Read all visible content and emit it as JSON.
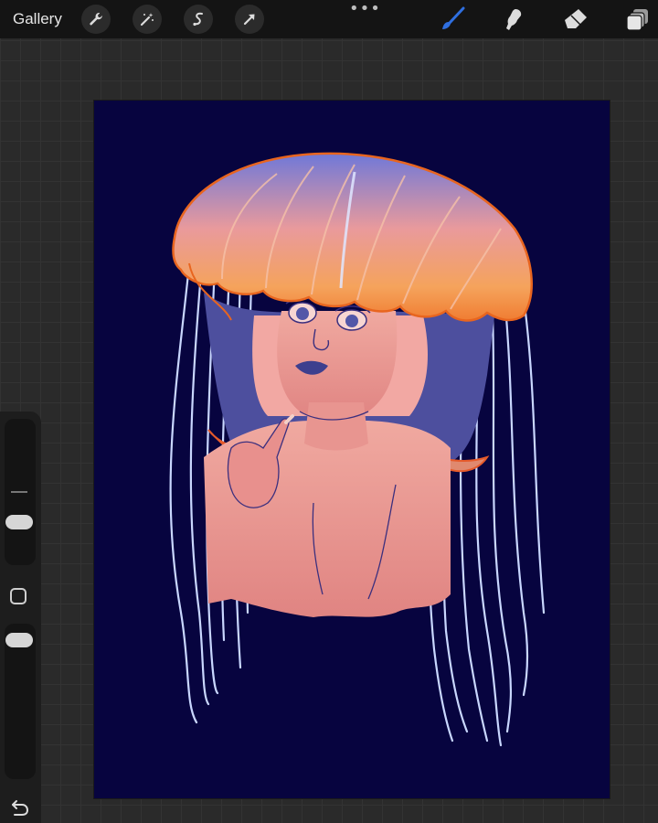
{
  "topbar": {
    "gallery_label": "Gallery",
    "left_tools": [
      "wrench-icon",
      "magic-wand-icon",
      "selection-icon",
      "transform-icon"
    ],
    "more_label": "•••",
    "right_tools": [
      "brush-icon",
      "smudge-icon",
      "eraser-icon",
      "layers-icon"
    ]
  },
  "colors": {
    "canvas_background": "#07043f",
    "active_tool": "#2f6fe0",
    "skin": "#e58a87",
    "bell_orange": "#f38a3c",
    "tentacle": "#c9d7ff"
  },
  "sidebar": {
    "tools": [
      "brush-size-slider",
      "modify-button",
      "opacity-slider",
      "undo-icon"
    ]
  }
}
